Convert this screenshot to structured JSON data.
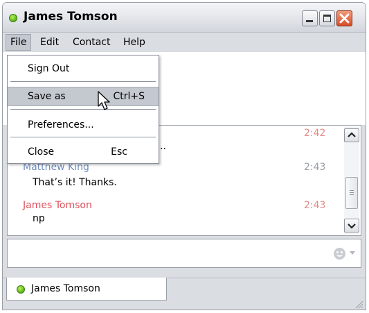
{
  "window": {
    "title": "James Tomson"
  },
  "menubar": {
    "items": [
      "File",
      "Edit",
      "Contact",
      "Help"
    ]
  },
  "file_menu": {
    "items": [
      {
        "label": "Sign Out",
        "shortcut": ""
      },
      {
        "label": "Save as",
        "shortcut": "Ctrl+S"
      },
      {
        "label": "Preferences...",
        "shortcut": ""
      },
      {
        "label": "Close",
        "shortcut": "Esc"
      }
    ]
  },
  "chat": {
    "messages": [
      {
        "sender": "",
        "time": "2:42",
        "text": ".."
      },
      {
        "sender": "Matthew King",
        "time": "2:43",
        "text": "That’s it! Thanks."
      },
      {
        "sender": "James Tomson",
        "time": "2:43",
        "text": "np"
      }
    ]
  },
  "input": {
    "value": "",
    "placeholder": ""
  },
  "tab": {
    "label": "James Tomson"
  },
  "colors": {
    "self_name": "#e0515a",
    "other_name": "#6f8cbc",
    "time": "#e58a86",
    "time_other": "#9aa0a8",
    "status": "#6cc21e"
  },
  "icons": [
    "status-online-icon",
    "minimize-icon",
    "maximize-icon",
    "close-icon",
    "scroll-up-icon",
    "scroll-down-icon",
    "smiley-icon",
    "dropdown-arrow-icon",
    "resize-grip-icon",
    "mouse-pointer-icon"
  ]
}
